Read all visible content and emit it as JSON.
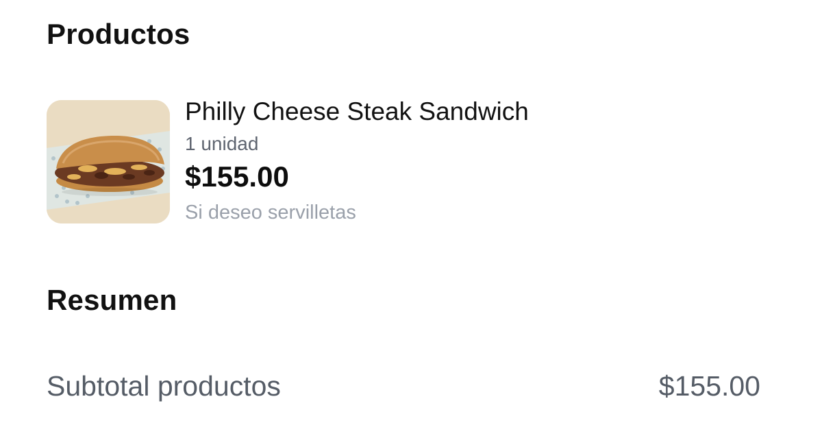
{
  "sections": {
    "products_title": "Productos",
    "summary_title": "Resumen"
  },
  "product": {
    "name": "Philly Cheese Steak Sandwich",
    "quantity": "1 unidad",
    "price": "$155.00",
    "note": "Si deseo servilletas",
    "image_icon": "sandwich-photo"
  },
  "summary": {
    "subtotal_label": "Subtotal productos",
    "subtotal_value": "$155.00"
  },
  "colors": {
    "text_primary": "#111111",
    "text_secondary": "#5f6570",
    "text_muted": "#9aa0aa",
    "summary_text": "#555c66"
  }
}
